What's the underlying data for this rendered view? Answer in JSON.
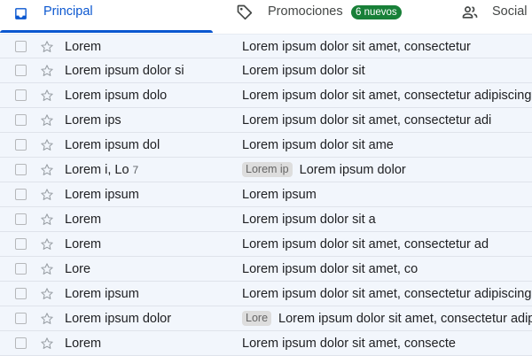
{
  "tabs": {
    "principal": {
      "label": "Principal",
      "icon": "inbox-icon"
    },
    "promociones": {
      "label": "Promociones",
      "icon": "tag-icon",
      "badge": "6 nuevos"
    },
    "social": {
      "label": "Social",
      "icon": "people-icon"
    }
  },
  "colors": {
    "accent": "#0b57d0",
    "badge": "#188038",
    "row_background": "#f2f6fc"
  },
  "emails": [
    {
      "sender": "Lorem",
      "count": "",
      "label": "",
      "subject": "Lorem ipsum dolor sit amet, consectetur"
    },
    {
      "sender": "Lorem ipsum dolor si",
      "count": "",
      "label": "",
      "subject": "Lorem ipsum dolor sit"
    },
    {
      "sender": "Lorem ipsum dolo",
      "count": "",
      "label": "",
      "subject": "Lorem ipsum dolor sit amet, consectetur adipiscing"
    },
    {
      "sender": "Lorem ips",
      "count": "",
      "label": "",
      "subject": "Lorem ipsum dolor sit amet, consectetur adi"
    },
    {
      "sender": "Lorem ipsum dol",
      "count": "",
      "label": "",
      "subject": "Lorem ipsum dolor sit ame"
    },
    {
      "sender": "Lorem i, Lo",
      "count": "7",
      "label": "Lorem ip",
      "subject": "Lorem ipsum dolor"
    },
    {
      "sender": "Lorem ipsum",
      "count": "",
      "label": "",
      "subject": "Lorem ipsum"
    },
    {
      "sender": "Lorem",
      "count": "",
      "label": "",
      "subject": "Lorem ipsum dolor sit a"
    },
    {
      "sender": "Lorem",
      "count": "",
      "label": "",
      "subject": "Lorem ipsum dolor sit amet, consectetur ad"
    },
    {
      "sender": "Lore",
      "count": "",
      "label": "",
      "subject": "Lorem ipsum dolor sit amet, co"
    },
    {
      "sender": "Lorem ipsum",
      "count": "",
      "label": "",
      "subject": "Lorem ipsum dolor sit amet, consectetur adipiscing"
    },
    {
      "sender": "Lorem ipsum dolor",
      "count": "",
      "label": "Lore",
      "subject": "Lorem ipsum dolor sit amet, consectetur adipi"
    },
    {
      "sender": "Lorem",
      "count": "",
      "label": "",
      "subject": "Lorem ipsum dolor sit amet, consecte"
    }
  ]
}
